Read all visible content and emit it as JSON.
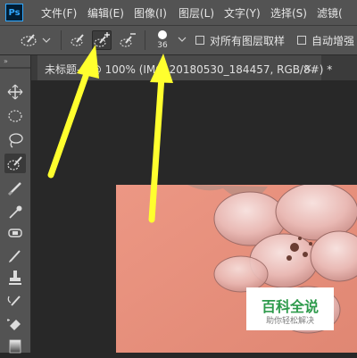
{
  "app": {
    "logo_text": "Ps"
  },
  "menu": {
    "items": [
      {
        "label": "文件(F)"
      },
      {
        "label": "编辑(E)"
      },
      {
        "label": "图像(I)"
      },
      {
        "label": "图层(L)"
      },
      {
        "label": "文字(Y)"
      },
      {
        "label": "选择(S)"
      },
      {
        "label": "滤镜("
      }
    ]
  },
  "options_bar": {
    "brush_size": "36",
    "sample_all_layers_label": "对所有图层取样",
    "sample_all_layers_checked": false,
    "auto_enhance_label": "自动增强",
    "auto_enhance_checked": false
  },
  "document": {
    "tab_title": "未标题-1 @ 100% (IMG_20180530_184457, RGB/8#) *",
    "close_symbol": "×"
  },
  "watermark": {
    "title": "百科全说",
    "subtitle": "助你轻松解决"
  },
  "colors": {
    "annotation_arrow": "#ffff2e",
    "panel": "#535353",
    "canvas_bg": "#282828",
    "photo_bg": "#e58f7d",
    "watermark_green": "#2d9a4b"
  }
}
